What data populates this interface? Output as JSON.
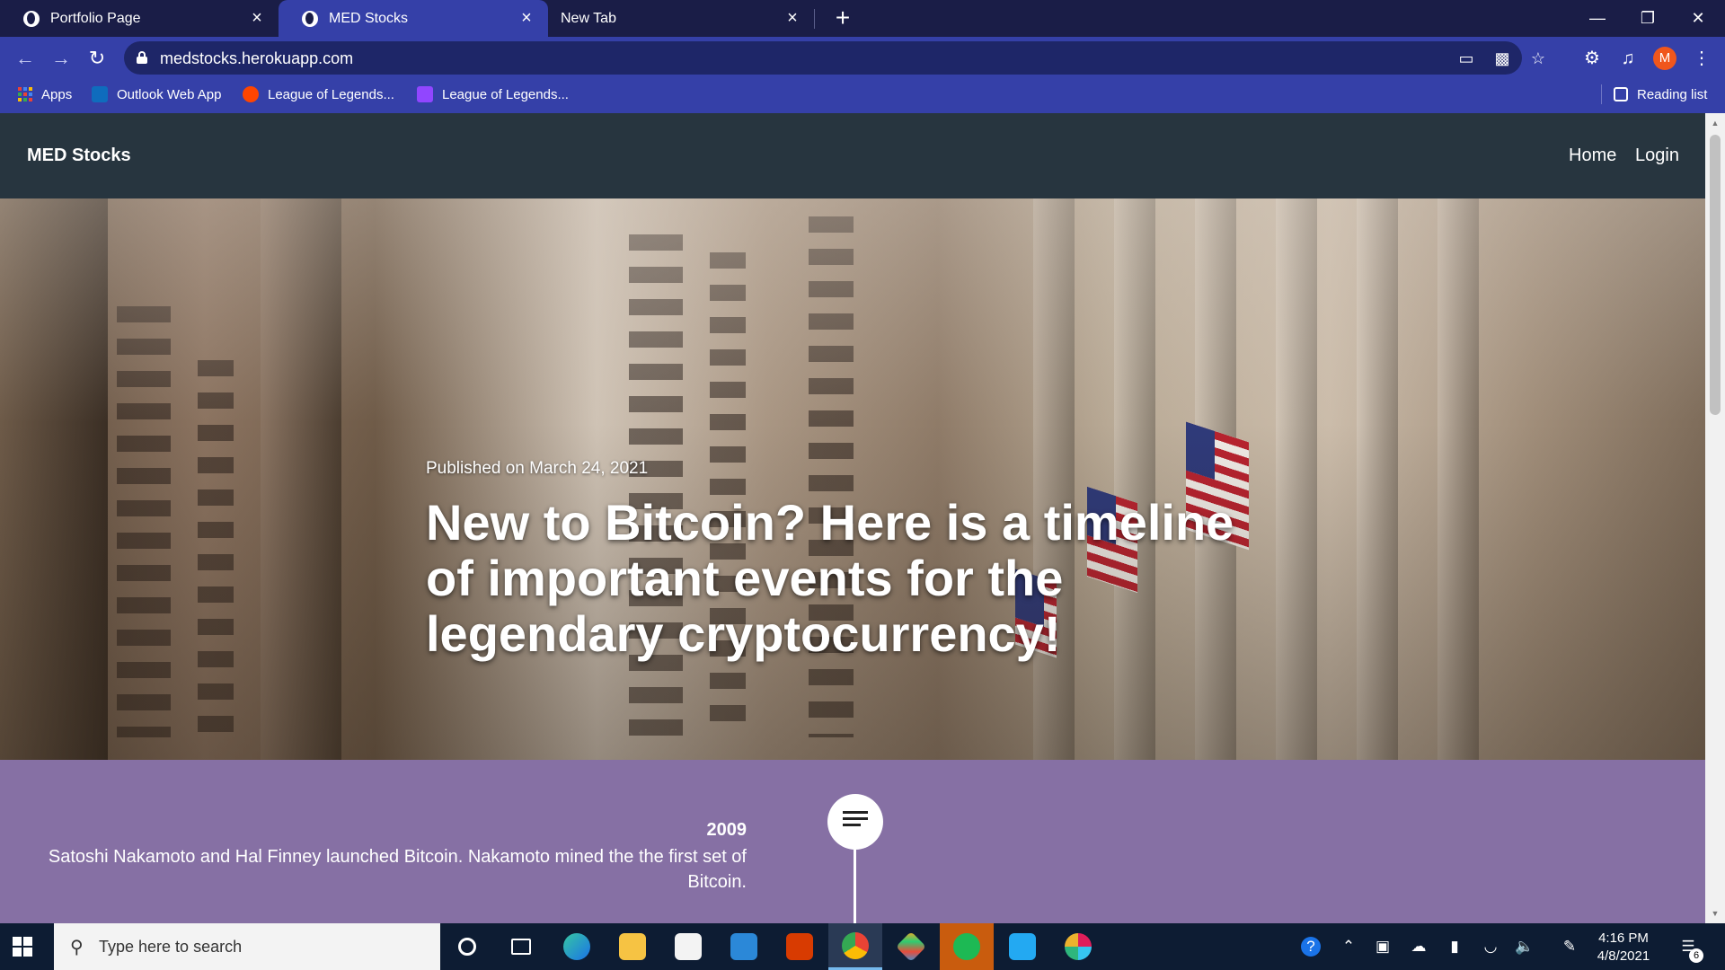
{
  "browser": {
    "tabs": [
      {
        "label": "Portfolio Page",
        "active": false
      },
      {
        "label": "MED Stocks",
        "active": true
      },
      {
        "label": "New Tab",
        "active": false
      }
    ],
    "url": "medstocks.herokuapp.com",
    "profile_initial": "M",
    "bookmarks": [
      {
        "label": "Apps",
        "icon": "apps-grid-icon"
      },
      {
        "label": "Outlook Web App",
        "icon": "outlook-icon"
      },
      {
        "label": "League of Legends...",
        "icon": "reddit-icon"
      },
      {
        "label": "League of Legends...",
        "icon": "twitch-icon"
      }
    ],
    "reading_list": "Reading list"
  },
  "site": {
    "brand": "MED Stocks",
    "nav": [
      "Home",
      "Login"
    ],
    "hero": {
      "date": "Published on March 24, 2021",
      "title": "New to Bitcoin? Here is a timeline of important events for the legendary cryptocurrency!"
    },
    "timeline": [
      {
        "year": "2009",
        "text": "Satoshi Nakamoto and Hal Finney launched Bitcoin. Nakamoto mined the the first set of Bitcoin."
      }
    ]
  },
  "taskbar": {
    "search_placeholder": "Type here to search",
    "time": "4:16 PM",
    "date": "4/8/2021",
    "notification_count": "6",
    "active_app": "chrome"
  },
  "colors": {
    "tab_strip": "#1a1d47",
    "toolbar": "#3540a8",
    "site_nav": "#27353f",
    "timeline_bg": "#8670a4",
    "taskbar": "#0d1c33"
  }
}
